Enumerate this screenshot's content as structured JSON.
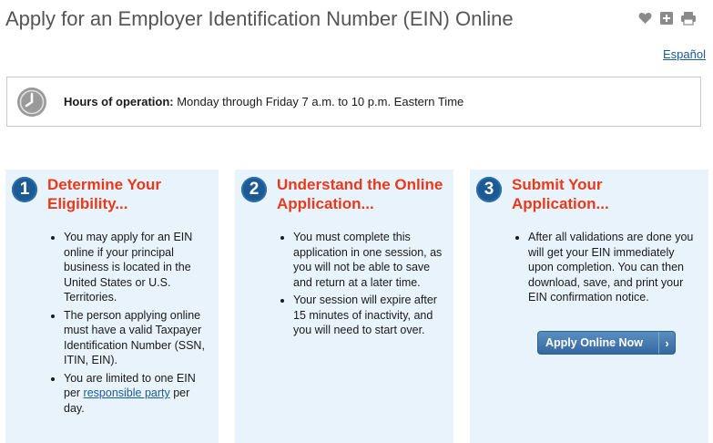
{
  "page": {
    "title": "Apply for an Employer Identification Number (EIN) Online"
  },
  "tools": {
    "favorite_icon": "heart-icon",
    "share_icon": "plus-box-icon",
    "print_icon": "printer-icon"
  },
  "language_link": "Español",
  "hours": {
    "label": "Hours of operation:",
    "text": " Monday through Friday 7 a.m. to 10 p.m. Eastern Time"
  },
  "steps": [
    {
      "number": "1",
      "title": "Determine Your Eligibility...",
      "bullets": [
        "You may apply for an EIN online if your principal business is located in the United States or U.S. Territories.",
        "The person applying online must have a valid Taxpayer Identification Number (SSN, ITIN, EIN)."
      ],
      "bullet3_before": "You are limited to one EIN per ",
      "bullet3_link": "responsible party",
      "bullet3_after": " per day."
    },
    {
      "number": "2",
      "title": "Understand the Online Application...",
      "bullets": [
        "You must complete this application in one session, as you will not be able to save and return at a later time.",
        "Your session will expire after 15 minutes of inactivity, and you will need to start over."
      ]
    },
    {
      "number": "3",
      "title": "Submit Your Application...",
      "bullets": [
        "After all validations are done you will get your EIN immediately upon completion. You can then download, save, and print your EIN confirmation notice."
      ],
      "button_label": "Apply Online Now"
    }
  ],
  "colors": {
    "accent_red": "#e8391d",
    "step_blue": "#1d5a94",
    "card_bg": "#e8f3fc",
    "link_blue": "#1a5b99"
  }
}
